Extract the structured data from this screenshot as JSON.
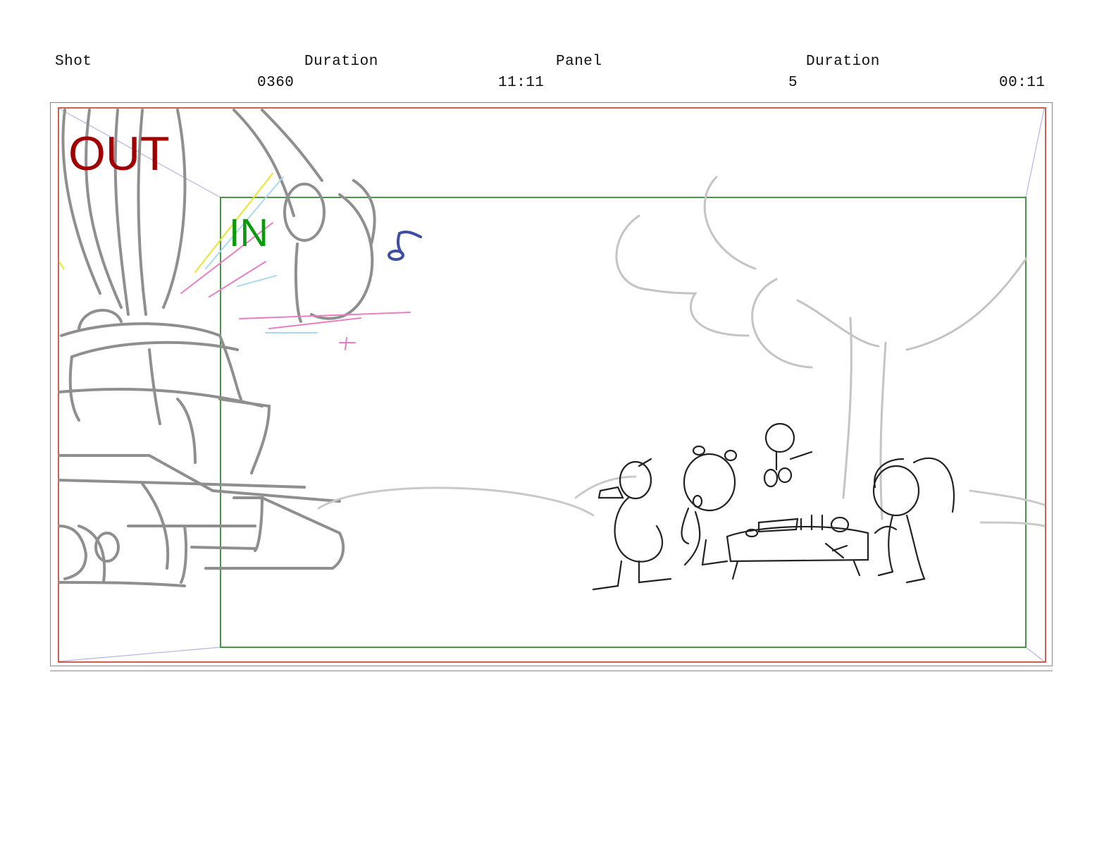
{
  "header": {
    "shot_label": "Shot",
    "duration_label_1": "Duration",
    "panel_label": "Panel",
    "duration_label_2": "Duration",
    "shot_value": "0360",
    "shot_duration_value": "11:11",
    "panel_value": "5",
    "panel_duration_value": "00:11"
  },
  "panel": {
    "out_label": "OUT",
    "in_label": "IN",
    "out_color": "#a00000",
    "in_color": "#0a9a0a",
    "out_frame_color": "#c0392b",
    "in_frame_color": "#1e7a1e"
  }
}
